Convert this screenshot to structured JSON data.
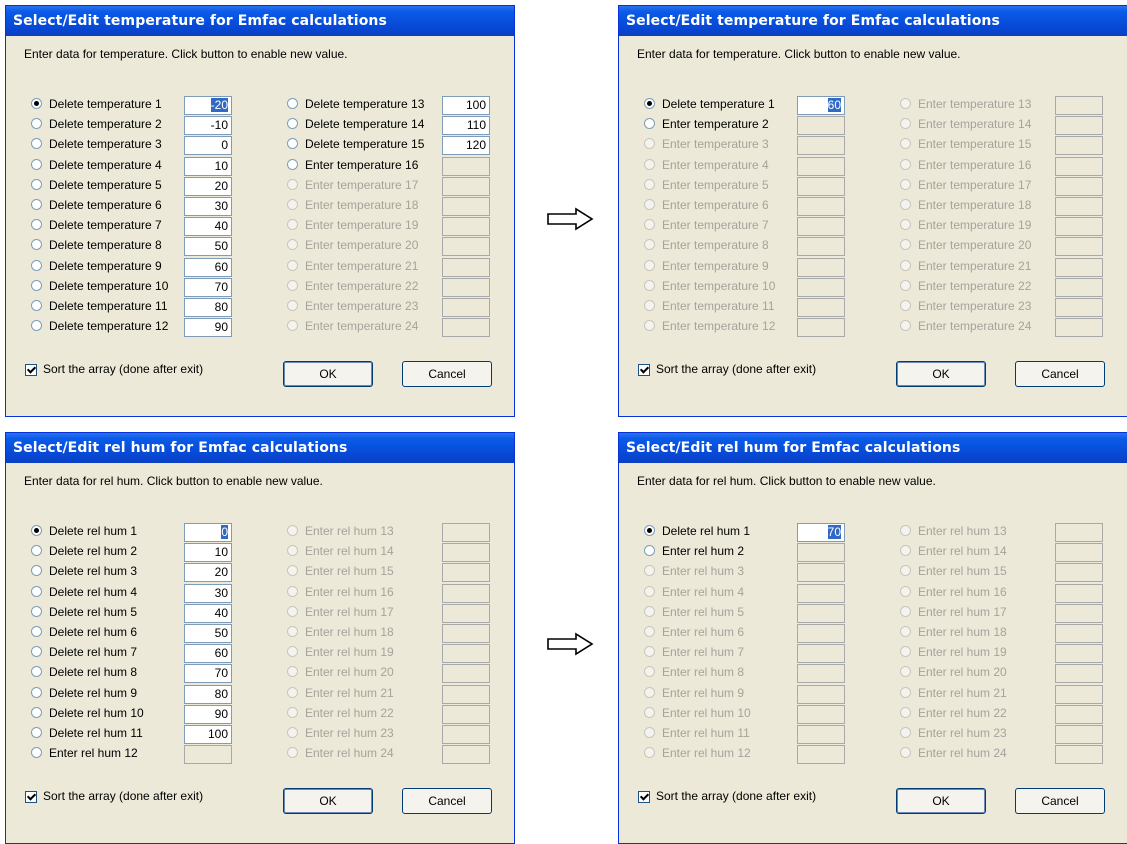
{
  "dialogs": [
    {
      "title": "Select/Edit temperature for Emfac calculations",
      "instruction": "Enter data for temperature.  Click button to enable new value.",
      "left_items": [
        {
          "label": "Delete temperature 1",
          "value": "-20",
          "state": "active",
          "selected": true,
          "highlight": true
        },
        {
          "label": "Delete temperature 2",
          "value": "-10",
          "state": "active"
        },
        {
          "label": "Delete temperature 3",
          "value": "0",
          "state": "active"
        },
        {
          "label": "Delete temperature 4",
          "value": "10",
          "state": "active"
        },
        {
          "label": "Delete temperature 5",
          "value": "20",
          "state": "active"
        },
        {
          "label": "Delete temperature 6",
          "value": "30",
          "state": "active"
        },
        {
          "label": "Delete temperature 7",
          "value": "40",
          "state": "active"
        },
        {
          "label": "Delete temperature 8",
          "value": "50",
          "state": "active"
        },
        {
          "label": "Delete temperature 9",
          "value": "60",
          "state": "active"
        },
        {
          "label": "Delete temperature 10",
          "value": "70",
          "state": "active"
        },
        {
          "label": "Delete temperature 11",
          "value": "80",
          "state": "active"
        },
        {
          "label": "Delete temperature 12",
          "value": "90",
          "state": "active"
        }
      ],
      "right_items": [
        {
          "label": "Delete temperature 13",
          "value": "100",
          "state": "active"
        },
        {
          "label": "Delete temperature 14",
          "value": "110",
          "state": "active"
        },
        {
          "label": "Delete temperature 15",
          "value": "120",
          "state": "active"
        },
        {
          "label": "Enter temperature 16",
          "value": "",
          "state": "enabled"
        },
        {
          "label": "Enter temperature 17",
          "value": "",
          "state": "disabled"
        },
        {
          "label": "Enter temperature 18",
          "value": "",
          "state": "disabled"
        },
        {
          "label": "Enter temperature 19",
          "value": "",
          "state": "disabled"
        },
        {
          "label": "Enter temperature 20",
          "value": "",
          "state": "disabled"
        },
        {
          "label": "Enter temperature 21",
          "value": "",
          "state": "disabled"
        },
        {
          "label": "Enter temperature 22",
          "value": "",
          "state": "disabled"
        },
        {
          "label": "Enter temperature 23",
          "value": "",
          "state": "disabled"
        },
        {
          "label": "Enter temperature 24",
          "value": "",
          "state": "disabled"
        }
      ],
      "sort_label": "Sort the array (done after exit)",
      "sort_checked": true,
      "ok_label": "OK",
      "cancel_label": "Cancel"
    },
    {
      "title": "Select/Edit temperature for Emfac calculations",
      "instruction": "Enter data for temperature.  Click button to enable new value.",
      "left_items": [
        {
          "label": "Delete temperature 1",
          "value": "60",
          "state": "active",
          "selected": true,
          "highlight": true
        },
        {
          "label": "Enter temperature 2",
          "value": "",
          "state": "enabled"
        },
        {
          "label": "Enter temperature 3",
          "value": "",
          "state": "disabled"
        },
        {
          "label": "Enter temperature 4",
          "value": "",
          "state": "disabled"
        },
        {
          "label": "Enter temperature 5",
          "value": "",
          "state": "disabled"
        },
        {
          "label": "Enter temperature 6",
          "value": "",
          "state": "disabled"
        },
        {
          "label": "Enter temperature 7",
          "value": "",
          "state": "disabled"
        },
        {
          "label": "Enter temperature 8",
          "value": "",
          "state": "disabled"
        },
        {
          "label": "Enter temperature 9",
          "value": "",
          "state": "disabled"
        },
        {
          "label": "Enter temperature 10",
          "value": "",
          "state": "disabled"
        },
        {
          "label": "Enter temperature 11",
          "value": "",
          "state": "disabled"
        },
        {
          "label": "Enter temperature 12",
          "value": "",
          "state": "disabled"
        }
      ],
      "right_items": [
        {
          "label": "Enter temperature 13",
          "value": "",
          "state": "disabled"
        },
        {
          "label": "Enter temperature 14",
          "value": "",
          "state": "disabled"
        },
        {
          "label": "Enter temperature 15",
          "value": "",
          "state": "disabled"
        },
        {
          "label": "Enter temperature 16",
          "value": "",
          "state": "disabled"
        },
        {
          "label": "Enter temperature 17",
          "value": "",
          "state": "disabled"
        },
        {
          "label": "Enter temperature 18",
          "value": "",
          "state": "disabled"
        },
        {
          "label": "Enter temperature 19",
          "value": "",
          "state": "disabled"
        },
        {
          "label": "Enter temperature 20",
          "value": "",
          "state": "disabled"
        },
        {
          "label": "Enter temperature 21",
          "value": "",
          "state": "disabled"
        },
        {
          "label": "Enter temperature 22",
          "value": "",
          "state": "disabled"
        },
        {
          "label": "Enter temperature 23",
          "value": "",
          "state": "disabled"
        },
        {
          "label": "Enter temperature 24",
          "value": "",
          "state": "disabled"
        }
      ],
      "sort_label": "Sort the array (done after exit)",
      "sort_checked": true,
      "ok_label": "OK",
      "cancel_label": "Cancel"
    },
    {
      "title": "Select/Edit rel hum for Emfac calculations",
      "instruction": "Enter data for rel hum.  Click button to enable new value.",
      "left_items": [
        {
          "label": "Delete rel hum 1",
          "value": "0",
          "state": "active",
          "selected": true,
          "highlight": true
        },
        {
          "label": "Delete rel hum 2",
          "value": "10",
          "state": "active"
        },
        {
          "label": "Delete rel hum 3",
          "value": "20",
          "state": "active"
        },
        {
          "label": "Delete rel hum 4",
          "value": "30",
          "state": "active"
        },
        {
          "label": "Delete rel hum 5",
          "value": "40",
          "state": "active"
        },
        {
          "label": "Delete rel hum 6",
          "value": "50",
          "state": "active"
        },
        {
          "label": "Delete rel hum 7",
          "value": "60",
          "state": "active"
        },
        {
          "label": "Delete rel hum 8",
          "value": "70",
          "state": "active"
        },
        {
          "label": "Delete rel hum 9",
          "value": "80",
          "state": "active"
        },
        {
          "label": "Delete rel hum 10",
          "value": "90",
          "state": "active"
        },
        {
          "label": "Delete rel hum 11",
          "value": "100",
          "state": "active"
        },
        {
          "label": "Enter rel hum 12",
          "value": "",
          "state": "enabled"
        }
      ],
      "right_items": [
        {
          "label": "Enter rel hum 13",
          "value": "",
          "state": "disabled"
        },
        {
          "label": "Enter rel hum 14",
          "value": "",
          "state": "disabled"
        },
        {
          "label": "Enter rel hum 15",
          "value": "",
          "state": "disabled"
        },
        {
          "label": "Enter rel hum 16",
          "value": "",
          "state": "disabled"
        },
        {
          "label": "Enter rel hum 17",
          "value": "",
          "state": "disabled"
        },
        {
          "label": "Enter rel hum 18",
          "value": "",
          "state": "disabled"
        },
        {
          "label": "Enter rel hum 19",
          "value": "",
          "state": "disabled"
        },
        {
          "label": "Enter rel hum 20",
          "value": "",
          "state": "disabled"
        },
        {
          "label": "Enter rel hum 21",
          "value": "",
          "state": "disabled"
        },
        {
          "label": "Enter rel hum 22",
          "value": "",
          "state": "disabled"
        },
        {
          "label": "Enter rel hum 23",
          "value": "",
          "state": "disabled"
        },
        {
          "label": "Enter rel hum 24",
          "value": "",
          "state": "disabled"
        }
      ],
      "sort_label": "Sort the array (done after exit)",
      "sort_checked": true,
      "ok_label": "OK",
      "cancel_label": "Cancel"
    },
    {
      "title": "Select/Edit rel hum for Emfac calculations",
      "instruction": "Enter data for rel hum.  Click button to enable new value.",
      "left_items": [
        {
          "label": "Delete rel hum 1",
          "value": "70",
          "state": "active",
          "selected": true,
          "highlight": true
        },
        {
          "label": "Enter rel hum 2",
          "value": "",
          "state": "enabled"
        },
        {
          "label": "Enter rel hum 3",
          "value": "",
          "state": "disabled"
        },
        {
          "label": "Enter rel hum 4",
          "value": "",
          "state": "disabled"
        },
        {
          "label": "Enter rel hum 5",
          "value": "",
          "state": "disabled"
        },
        {
          "label": "Enter rel hum 6",
          "value": "",
          "state": "disabled"
        },
        {
          "label": "Enter rel hum 7",
          "value": "",
          "state": "disabled"
        },
        {
          "label": "Enter rel hum 8",
          "value": "",
          "state": "disabled"
        },
        {
          "label": "Enter rel hum 9",
          "value": "",
          "state": "disabled"
        },
        {
          "label": "Enter rel hum 10",
          "value": "",
          "state": "disabled"
        },
        {
          "label": "Enter rel hum 11",
          "value": "",
          "state": "disabled"
        },
        {
          "label": "Enter rel hum 12",
          "value": "",
          "state": "disabled"
        }
      ],
      "right_items": [
        {
          "label": "Enter rel hum 13",
          "value": "",
          "state": "disabled"
        },
        {
          "label": "Enter rel hum 14",
          "value": "",
          "state": "disabled"
        },
        {
          "label": "Enter rel hum 15",
          "value": "",
          "state": "disabled"
        },
        {
          "label": "Enter rel hum 16",
          "value": "",
          "state": "disabled"
        },
        {
          "label": "Enter rel hum 17",
          "value": "",
          "state": "disabled"
        },
        {
          "label": "Enter rel hum 18",
          "value": "",
          "state": "disabled"
        },
        {
          "label": "Enter rel hum 19",
          "value": "",
          "state": "disabled"
        },
        {
          "label": "Enter rel hum 20",
          "value": "",
          "state": "disabled"
        },
        {
          "label": "Enter rel hum 21",
          "value": "",
          "state": "disabled"
        },
        {
          "label": "Enter rel hum 22",
          "value": "",
          "state": "disabled"
        },
        {
          "label": "Enter rel hum 23",
          "value": "",
          "state": "disabled"
        },
        {
          "label": "Enter rel hum 24",
          "value": "",
          "state": "disabled"
        }
      ],
      "sort_label": "Sort the array (done after exit)",
      "sort_checked": true,
      "ok_label": "OK",
      "cancel_label": "Cancel"
    }
  ],
  "arrows": [
    "right-arrow-icon",
    "right-arrow-icon"
  ],
  "colors": {
    "titlebar": "#0a5ae8",
    "dialog_bg": "#ece9d8",
    "disabled_text": "#a6a39b",
    "selection": "#316ac5"
  }
}
